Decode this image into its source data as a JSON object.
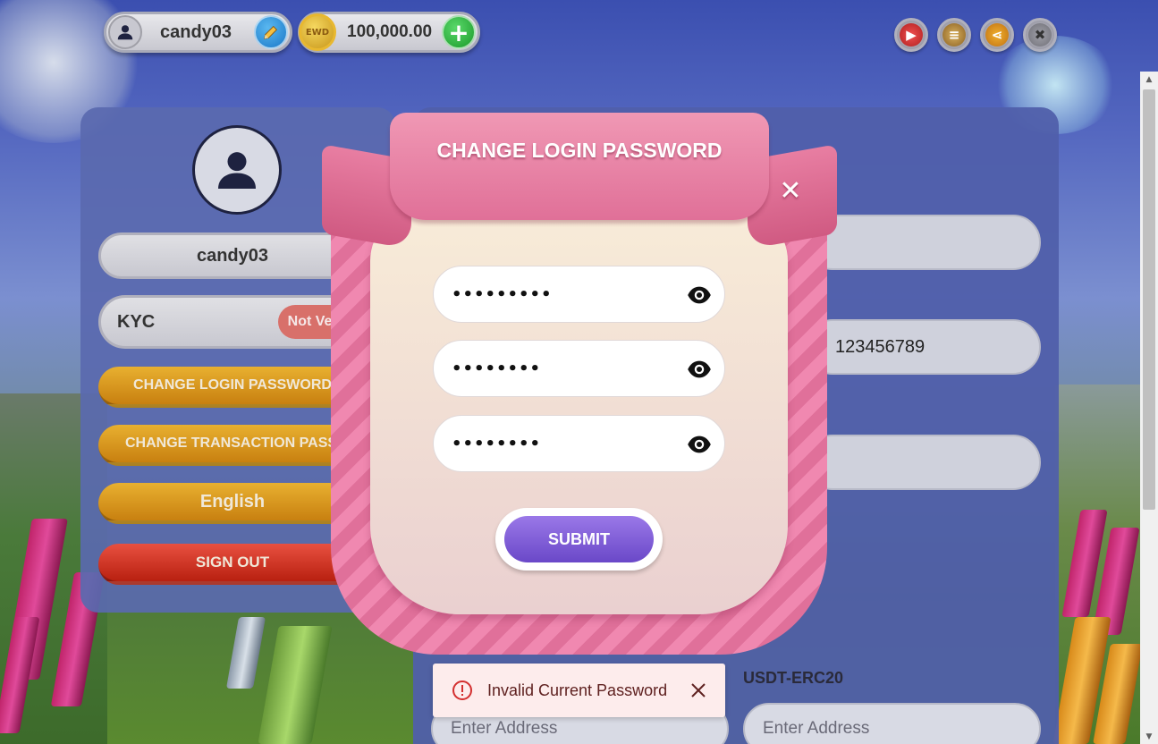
{
  "header": {
    "username": "candy03",
    "coin_label": "EWD",
    "balance": "100,000.00"
  },
  "profile": {
    "username": "candy03",
    "kyc_label": "KYC",
    "kyc_status": "Not Verify",
    "buttons": {
      "change_login_password": "CHANGE LOGIN PASSWORD",
      "change_transaction_password": "CHANGE TRANSACTION PASSWORD",
      "language": "English",
      "sign_out": "SIGN OUT"
    }
  },
  "details": {
    "phone_value": "123456789",
    "usdt_label": "USDT-ERC20",
    "address_placeholder_left": "Enter Address",
    "address_placeholder_right": "Enter Address"
  },
  "modal": {
    "title": "CHANGE LOGIN PASSWORD",
    "fields": [
      {
        "value": "•••••••••"
      },
      {
        "value": "••••••••"
      },
      {
        "value": "••••••••"
      }
    ],
    "submit_label": "SUBMIT"
  },
  "toast": {
    "message": "Invalid Current Password",
    "severity_color": "#d32f2f"
  },
  "colors": {
    "ribbon_pink": "#e07098",
    "submit_purple": "#7a58d8",
    "kyc_badge": "#d8706a",
    "accent_yellow": "#e8b030",
    "sign_out_red": "#e85040"
  }
}
